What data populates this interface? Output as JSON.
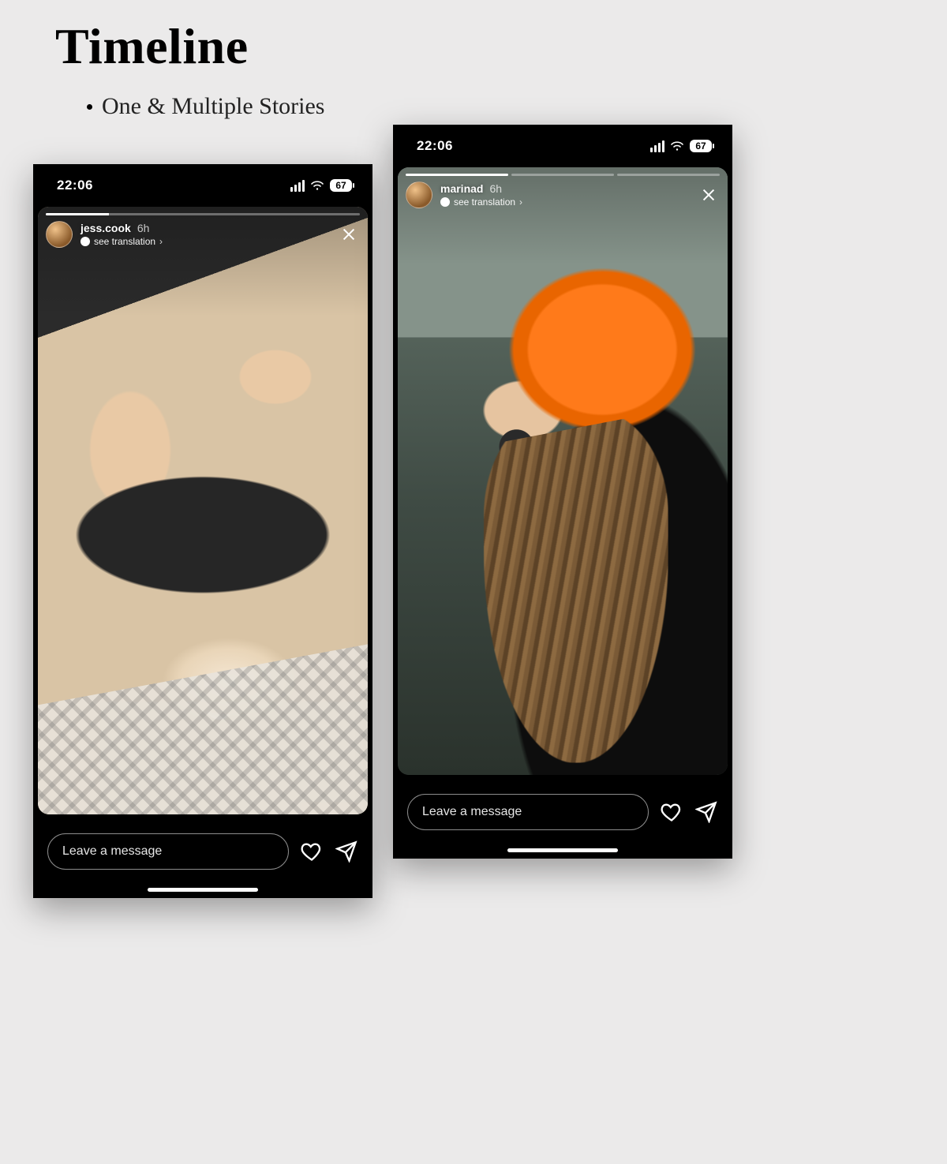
{
  "page": {
    "title": "Timeline",
    "subtitle": "One & Multiple Stories"
  },
  "status": {
    "time": "22:06",
    "battery": "67"
  },
  "stories": {
    "left": {
      "username": "jess.cook",
      "timestamp": "6h",
      "translation_label": "see translation",
      "message_placeholder": "Leave a message",
      "segments": 1,
      "progress_fill_pct": 20
    },
    "right": {
      "username": "marinad",
      "timestamp": "6h",
      "translation_label": "see translation",
      "message_placeholder": "Leave a message",
      "segments": 3,
      "progress_fill_pct": 100
    }
  }
}
